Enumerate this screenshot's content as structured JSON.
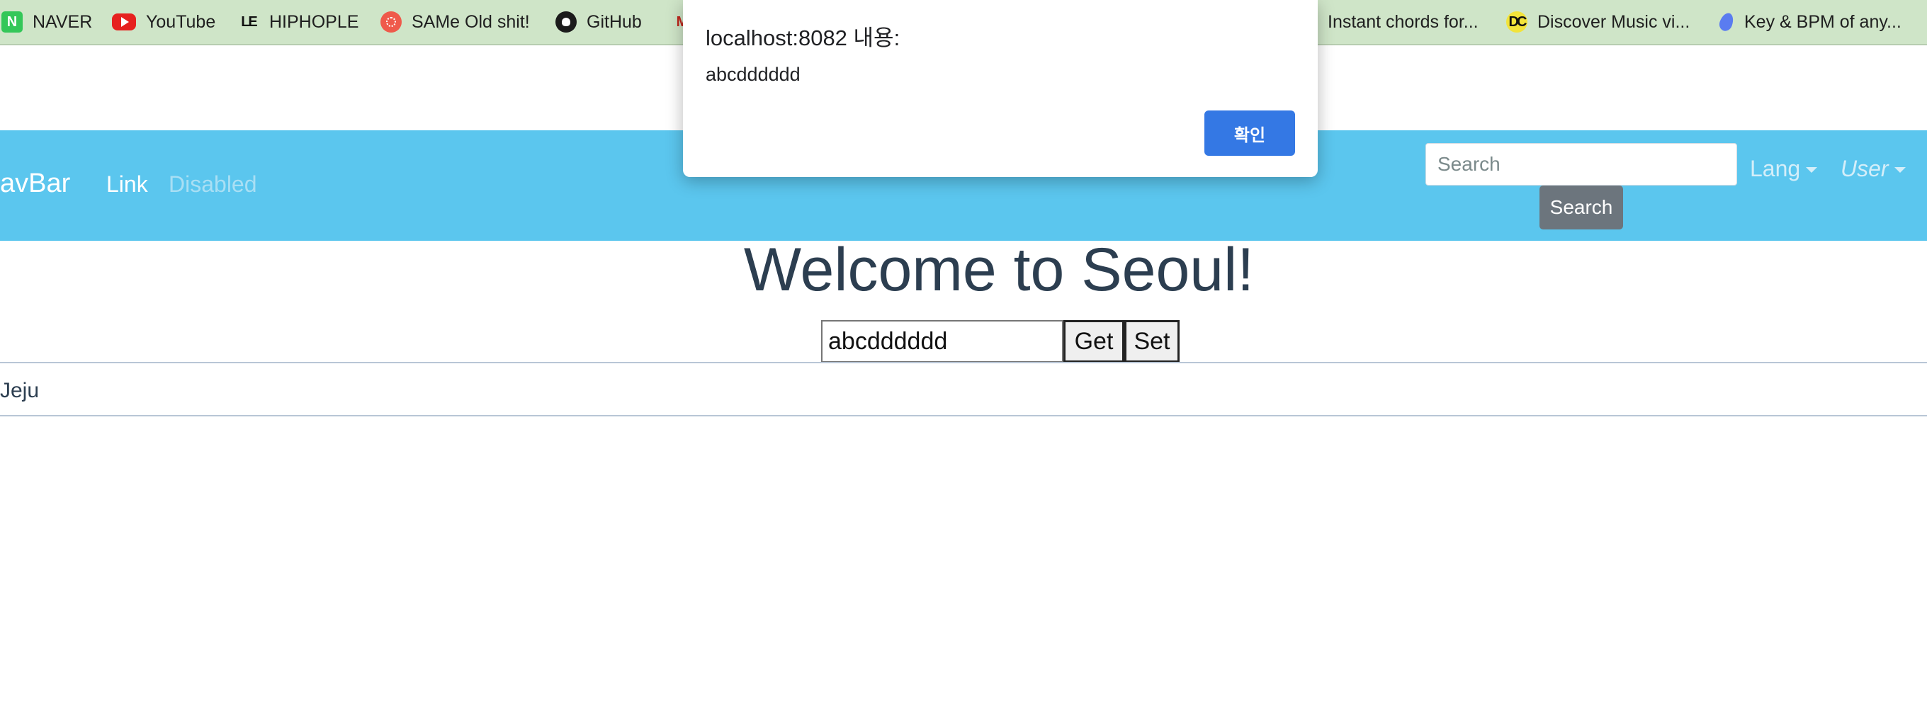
{
  "bookmarks": [
    {
      "label": "NAVER",
      "icon": "naver-icon"
    },
    {
      "label": "YouTube",
      "icon": "youtube-icon"
    },
    {
      "label": "HIPHOPLE",
      "icon": "hiphople-icon"
    },
    {
      "label": "SAMe Old shit!",
      "icon": "same-old-icon"
    },
    {
      "label": "GitHub",
      "icon": "github-icon"
    },
    {
      "label": "",
      "icon": "m-icon"
    },
    {
      "label": "Instant chords for...",
      "icon": ""
    },
    {
      "label": "Discover Music vi...",
      "icon": "discover-icon"
    },
    {
      "label": "Key & BPM of any...",
      "icon": "key-bpm-icon"
    }
  ],
  "navbar": {
    "brand": "avBar",
    "links": [
      "Link",
      "Disabled"
    ],
    "search_placeholder": "Search",
    "search_button": "Search",
    "lang": "Lang",
    "user": "User",
    "bg_color": "#5bc6ee"
  },
  "main": {
    "title": "Welcome to Seoul!",
    "input_value": "abcdddddd",
    "get_label": "Get",
    "set_label": "Set",
    "list": [
      "Jeju"
    ]
  },
  "dialog": {
    "title": "localhost:8082 내용:",
    "message": "abcdddddd",
    "ok_label": "확인",
    "ok_color": "#3478e4"
  }
}
